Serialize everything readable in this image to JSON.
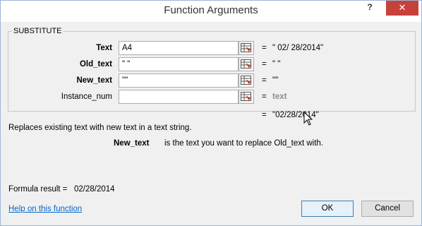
{
  "window": {
    "title": "Function Arguments",
    "help_glyph": "?",
    "close_glyph": "✕"
  },
  "function_name": "SUBSTITUTE",
  "arguments": [
    {
      "label": "Text",
      "value": "A4",
      "eq": "=",
      "result": "\" 02/ 28/2014\""
    },
    {
      "label": "Old_text",
      "value": "\" \"",
      "eq": "=",
      "result": "\" \""
    },
    {
      "label": "New_text",
      "value": "\"\"",
      "eq": "=",
      "result": "\"\""
    },
    {
      "label": "Instance_num",
      "value": "",
      "eq": "=",
      "result": "text"
    }
  ],
  "total": {
    "eq": "=",
    "result": "\"02/28/2014\""
  },
  "description": "Replaces existing text with new text in a text string.",
  "arg_description": {
    "name": "New_text",
    "text": "is the text you want to replace Old_text with."
  },
  "formula": {
    "label": "Formula result =",
    "value": "02/28/2014"
  },
  "help_link": "Help on this function",
  "buttons": {
    "ok": "OK",
    "cancel": "Cancel"
  },
  "colors": {
    "close_button": "#c7413b",
    "link": "#0066cc",
    "disabled_text": "#8c8c8c"
  }
}
